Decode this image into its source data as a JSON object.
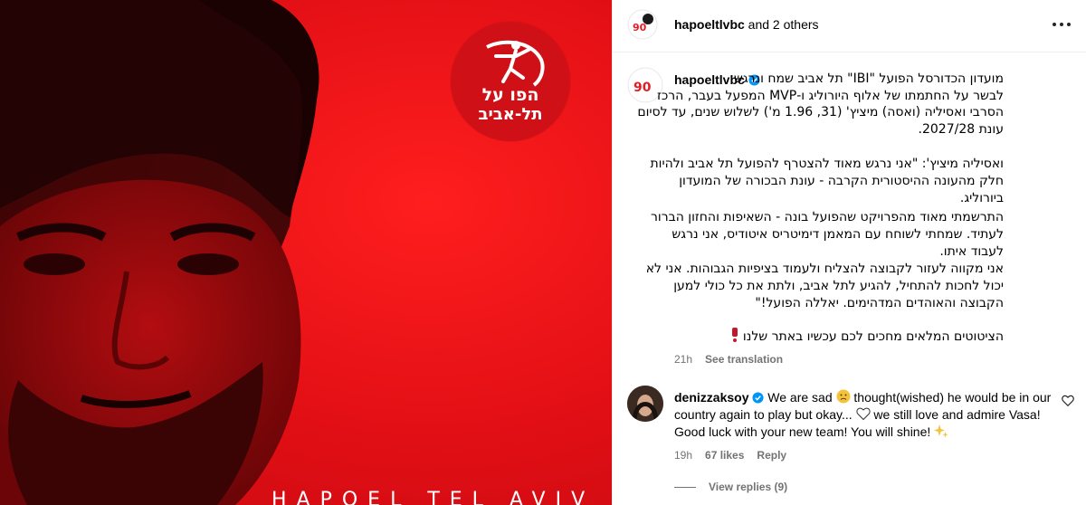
{
  "media": {
    "logo_line1": "הפו על",
    "logo_line2": "תל-אביב",
    "bottom_caption": "HAPOEL TEL AVIV",
    "bg_color": "#e8101a"
  },
  "header": {
    "username": "hapoeltlvbc",
    "others": " and 2 others",
    "avatar_badge": "90"
  },
  "caption": {
    "username": "hapoeltlvbc",
    "lines": [
      "מועדון הכדורסל הפועל \"IBI\" תל אביב שמח ונרגש",
      "לבשר על החתמתו של אלוף היורוליג ו-MVP המפעל בעבר, הרכז",
      "הסרבי ואסיליה (ואסה) מיציץ' (31, 1.96 מ') לשלוש שנים, עד לסיום",
      "עונת 2027/28.",
      "ואסיליה מיציץ': \"אני נרגש מאוד להצטרף להפועל תל אביב ולהיות",
      "חלק מהעונה ההיסטורית הקרבה - עונת הבכורה של המועדון",
      "ביורוליג.",
      "התרשמתי מאוד מהפרויקט שהפועל בונה - השאיפות והחזון הברור",
      "לעתיד. שמחתי לשוחח עם המאמן דימיטריס איטודיס, אני נרגש",
      "לעבוד איתו.",
      "אני מקווה לעזור לקבוצה להצליח ולעמוד בציפיות הגבוהות. אני לא",
      "יכול לחכות להתחיל, להגיע לתל אביב, ולתת את כל כולי למען",
      "הקבוצה והאוהדים המדהימים. יאללה הפועל!\"",
      "הציטוטים המלאים מחכים לכם עכשיו באתר שלנו"
    ],
    "time": "21h",
    "see_translation": "See translation"
  },
  "comment": {
    "username": "denizzaksoy",
    "text_a": " We are sad ",
    "text_b": " thought(wished) he would be in our country again to play but okay... ",
    "text_c": " we still love and admire Vasa! Good luck with your new team! You will shine! ",
    "time": "19h",
    "likes": "67 likes",
    "reply": "Reply",
    "view_replies": "View replies (9)"
  }
}
